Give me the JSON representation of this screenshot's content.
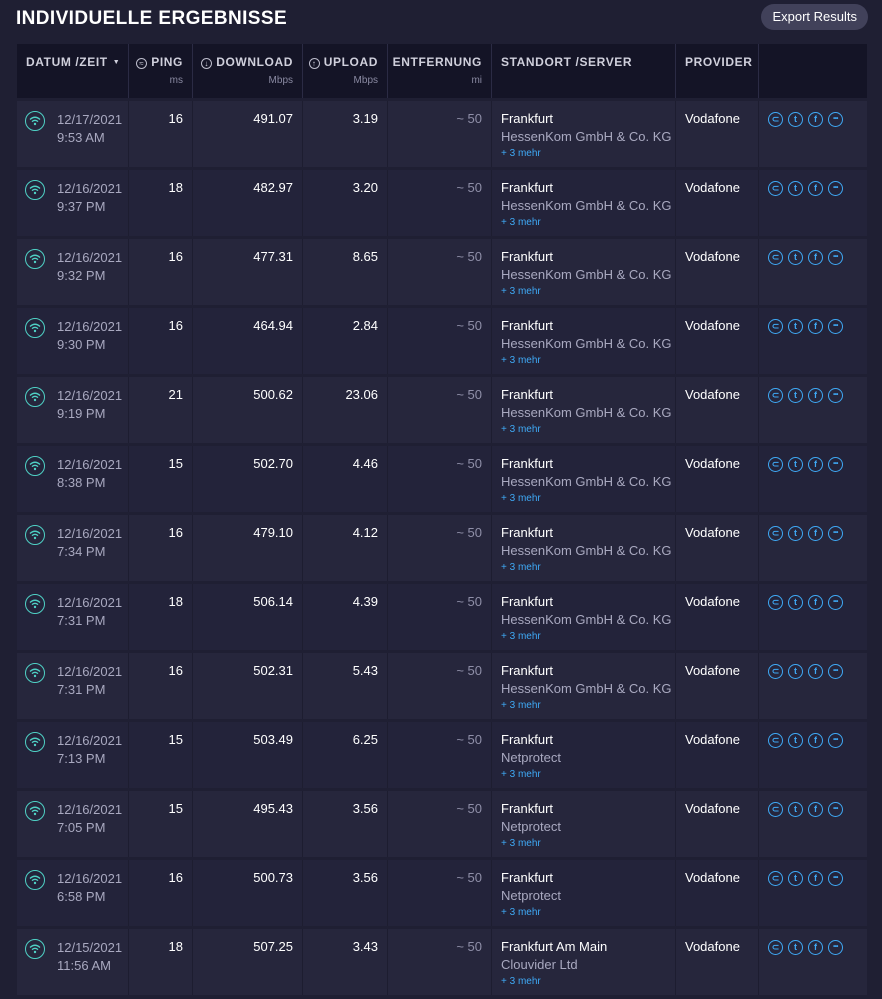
{
  "header": {
    "title": "INDIVIDUELLE ERGEBNISSE",
    "export_label": "Export Results"
  },
  "columns": {
    "date": {
      "label": "DATUM /ZEIT",
      "sort": "▼"
    },
    "ping": {
      "label": "PING",
      "unit": "ms",
      "icon": "ping-icon"
    },
    "download": {
      "label": "DOWNLOAD",
      "unit": "Mbps",
      "icon": "download-icon"
    },
    "upload": {
      "label": "UPLOAD",
      "unit": "Mbps",
      "icon": "upload-icon"
    },
    "distance": {
      "label": "ENTFERNUNG",
      "unit": "mi"
    },
    "server": {
      "label": "STANDORT /SERVER"
    },
    "provider": {
      "label": "PROVIDER"
    }
  },
  "colors": {
    "background": "#1f1f33",
    "accent": "#3fa9f5",
    "wifi": "#4fd1c5",
    "header_bg": "#141426"
  },
  "rows": [
    {
      "date": "12/17/2021",
      "time": "9:53 AM",
      "ping": "16",
      "download": "491.07",
      "upload": "3.19",
      "distance": "~ 50",
      "location": "Frankfurt",
      "host": "HessenKom GmbH & Co. KG",
      "more": "+ 3 mehr",
      "provider": "Vodafone"
    },
    {
      "date": "12/16/2021",
      "time": "9:37 PM",
      "ping": "18",
      "download": "482.97",
      "upload": "3.20",
      "distance": "~ 50",
      "location": "Frankfurt",
      "host": "HessenKom GmbH & Co. KG",
      "more": "+ 3 mehr",
      "provider": "Vodafone"
    },
    {
      "date": "12/16/2021",
      "time": "9:32 PM",
      "ping": "16",
      "download": "477.31",
      "upload": "8.65",
      "distance": "~ 50",
      "location": "Frankfurt",
      "host": "HessenKom GmbH & Co. KG",
      "more": "+ 3 mehr",
      "provider": "Vodafone"
    },
    {
      "date": "12/16/2021",
      "time": "9:30 PM",
      "ping": "16",
      "download": "464.94",
      "upload": "2.84",
      "distance": "~ 50",
      "location": "Frankfurt",
      "host": "HessenKom GmbH & Co. KG",
      "more": "+ 3 mehr",
      "provider": "Vodafone"
    },
    {
      "date": "12/16/2021",
      "time": "9:19 PM",
      "ping": "21",
      "download": "500.62",
      "upload": "23.06",
      "distance": "~ 50",
      "location": "Frankfurt",
      "host": "HessenKom GmbH & Co. KG",
      "more": "+ 3 mehr",
      "provider": "Vodafone"
    },
    {
      "date": "12/16/2021",
      "time": "8:38 PM",
      "ping": "15",
      "download": "502.70",
      "upload": "4.46",
      "distance": "~ 50",
      "location": "Frankfurt",
      "host": "HessenKom GmbH & Co. KG",
      "more": "+ 3 mehr",
      "provider": "Vodafone"
    },
    {
      "date": "12/16/2021",
      "time": "7:34 PM",
      "ping": "16",
      "download": "479.10",
      "upload": "4.12",
      "distance": "~ 50",
      "location": "Frankfurt",
      "host": "HessenKom GmbH & Co. KG",
      "more": "+ 3 mehr",
      "provider": "Vodafone"
    },
    {
      "date": "12/16/2021",
      "time": "7:31 PM",
      "ping": "18",
      "download": "506.14",
      "upload": "4.39",
      "distance": "~ 50",
      "location": "Frankfurt",
      "host": "HessenKom GmbH & Co. KG",
      "more": "+ 3 mehr",
      "provider": "Vodafone"
    },
    {
      "date": "12/16/2021",
      "time": "7:31 PM",
      "ping": "16",
      "download": "502.31",
      "upload": "5.43",
      "distance": "~ 50",
      "location": "Frankfurt",
      "host": "HessenKom GmbH & Co. KG",
      "more": "+ 3 mehr",
      "provider": "Vodafone"
    },
    {
      "date": "12/16/2021",
      "time": "7:13 PM",
      "ping": "15",
      "download": "503.49",
      "upload": "6.25",
      "distance": "~ 50",
      "location": "Frankfurt",
      "host": "Netprotect",
      "more": "+ 3 mehr",
      "provider": "Vodafone"
    },
    {
      "date": "12/16/2021",
      "time": "7:05 PM",
      "ping": "15",
      "download": "495.43",
      "upload": "3.56",
      "distance": "~ 50",
      "location": "Frankfurt",
      "host": "Netprotect",
      "more": "+ 3 mehr",
      "provider": "Vodafone"
    },
    {
      "date": "12/16/2021",
      "time": "6:58 PM",
      "ping": "16",
      "download": "500.73",
      "upload": "3.56",
      "distance": "~ 50",
      "location": "Frankfurt",
      "host": "Netprotect",
      "more": "+ 3 mehr",
      "provider": "Vodafone"
    },
    {
      "date": "12/15/2021",
      "time": "11:56 AM",
      "ping": "18",
      "download": "507.25",
      "upload": "3.43",
      "distance": "~ 50",
      "location": "Frankfurt Am Main",
      "host": "Clouvider Ltd",
      "more": "+ 3 mehr",
      "provider": "Vodafone"
    }
  ],
  "share_icons": [
    "link-icon",
    "twitter-icon",
    "facebook-icon",
    "more-icon"
  ]
}
